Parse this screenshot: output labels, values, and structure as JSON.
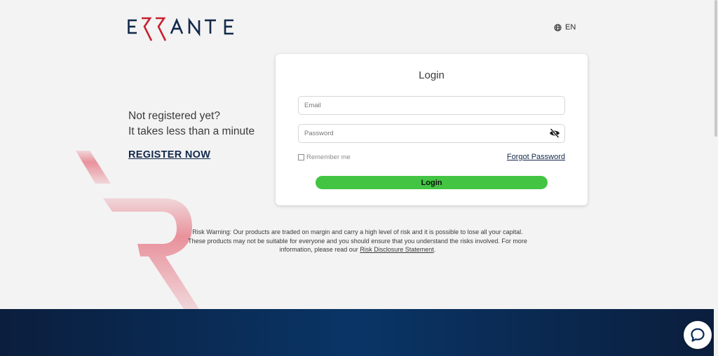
{
  "brand": {
    "logo_text": "ERRANTE",
    "navy_color": "#13294b",
    "red_color": "#c8202f"
  },
  "header": {
    "language_icon": "globe-icon",
    "language_label": "EN"
  },
  "promo": {
    "line1": "Not registered yet?",
    "line2": "It takes less than a minute",
    "register_label": "REGISTER NOW"
  },
  "login_form": {
    "title": "Login",
    "email_placeholder": "Email",
    "email_value": "",
    "password_placeholder": "Password",
    "password_value": "",
    "password_toggle_icon": "eye-slash-icon",
    "remember_label": "Remember me",
    "remember_checked": false,
    "forgot_label": "Forgot Password",
    "submit_label": "Login",
    "submit_color": "#43c443"
  },
  "risk_warning": {
    "text": "Risk Warning: Our products are traded on margin and carry a high level of risk and it is possible to lose all your capital. These products may not be suitable for everyone and you should ensure that you understand the risks involved. For more information, please read our",
    "link_label": "Risk Disclosure Statement",
    "suffix": "."
  },
  "footer": {
    "color": "#0b2a55"
  },
  "chat": {
    "icon": "chat-bubble-icon"
  }
}
